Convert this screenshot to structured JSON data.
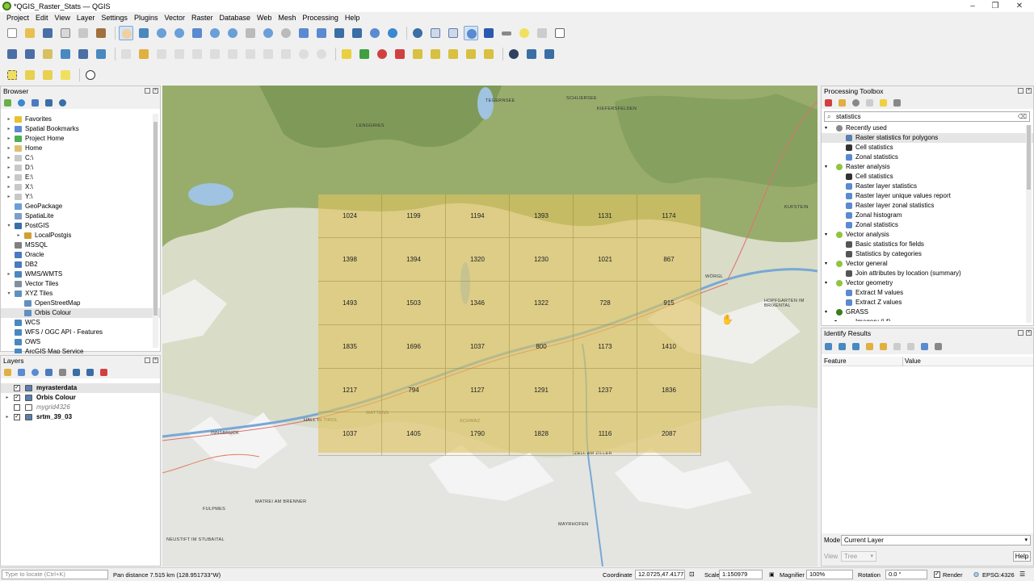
{
  "window": {
    "title": "*QGIS_Raster_Stats — QGIS",
    "minimize": "–",
    "restore": "❐",
    "close": "✕"
  },
  "menu": [
    "Project",
    "Edit",
    "View",
    "Layer",
    "Settings",
    "Plugins",
    "Vector",
    "Raster",
    "Database",
    "Web",
    "Mesh",
    "Processing",
    "Help"
  ],
  "browser": {
    "title": "Browser",
    "items": [
      {
        "label": "Favorites",
        "indent": 0,
        "icon": "star-icon",
        "color": "#e8c030",
        "arrow": "▸"
      },
      {
        "label": "Spatial Bookmarks",
        "indent": 0,
        "icon": "bookmark-icon",
        "color": "#5a8ad0",
        "arrow": "▸"
      },
      {
        "label": "Project Home",
        "indent": 0,
        "icon": "folder-icon",
        "color": "#4caf50",
        "arrow": "▸"
      },
      {
        "label": "Home",
        "indent": 0,
        "icon": "folder-icon",
        "color": "#e0c070",
        "arrow": "▸"
      },
      {
        "label": "C:\\",
        "indent": 0,
        "icon": "drive-icon",
        "color": "#c8c8c8",
        "arrow": "▸"
      },
      {
        "label": "D:\\",
        "indent": 0,
        "icon": "drive-icon",
        "color": "#c8c8c8",
        "arrow": "▸"
      },
      {
        "label": "E:\\",
        "indent": 0,
        "icon": "drive-icon",
        "color": "#c8c8c8",
        "arrow": "▸"
      },
      {
        "label": "X:\\",
        "indent": 0,
        "icon": "drive-icon",
        "color": "#c8c8c8",
        "arrow": "▸"
      },
      {
        "label": "Y:\\",
        "indent": 0,
        "icon": "drive-icon",
        "color": "#c8c8c8",
        "arrow": "▸"
      },
      {
        "label": "GeoPackage",
        "indent": 0,
        "icon": "geopackage-icon",
        "color": "#6a9fd8",
        "arrow": ""
      },
      {
        "label": "SpatiaLite",
        "indent": 0,
        "icon": "spatialite-icon",
        "color": "#7aa0c8",
        "arrow": ""
      },
      {
        "label": "PostGIS",
        "indent": 0,
        "icon": "postgis-icon",
        "color": "#3a6ea5",
        "arrow": "▾"
      },
      {
        "label": "LocalPostgis",
        "indent": 1,
        "icon": "connection-icon",
        "color": "#d0a030",
        "arrow": "▸"
      },
      {
        "label": "MSSQL",
        "indent": 0,
        "icon": "mssql-icon",
        "color": "#808080",
        "arrow": ""
      },
      {
        "label": "Oracle",
        "indent": 0,
        "icon": "oracle-icon",
        "color": "#4a7ac0",
        "arrow": ""
      },
      {
        "label": "DB2",
        "indent": 0,
        "icon": "db2-icon",
        "color": "#4a7ac0",
        "arrow": ""
      },
      {
        "label": "WMS/WMTS",
        "indent": 0,
        "icon": "wms-icon",
        "color": "#4a88c0",
        "arrow": "▸"
      },
      {
        "label": "Vector Tiles",
        "indent": 0,
        "icon": "vector-tiles-icon",
        "color": "#8090a0",
        "arrow": ""
      },
      {
        "label": "XYZ Tiles",
        "indent": 0,
        "icon": "xyz-tiles-icon",
        "color": "#6090c0",
        "arrow": "▾"
      },
      {
        "label": "OpenStreetMap",
        "indent": 1,
        "icon": "xyz-tiles-icon",
        "color": "#6090c0",
        "arrow": ""
      },
      {
        "label": "Orbis Colour",
        "indent": 1,
        "icon": "xyz-tiles-icon",
        "color": "#6090c0",
        "arrow": "",
        "selected": true
      },
      {
        "label": "WCS",
        "indent": 0,
        "icon": "wcs-icon",
        "color": "#4a88c0",
        "arrow": ""
      },
      {
        "label": "WFS / OGC API - Features",
        "indent": 0,
        "icon": "wfs-icon",
        "color": "#4a88c0",
        "arrow": ""
      },
      {
        "label": "OWS",
        "indent": 0,
        "icon": "ows-icon",
        "color": "#4a88c0",
        "arrow": ""
      },
      {
        "label": "ArcGIS Map Service",
        "indent": 0,
        "icon": "arcgis-icon",
        "color": "#4a88c0",
        "arrow": ""
      }
    ]
  },
  "layers": {
    "title": "Layers",
    "items": [
      {
        "label": "myrasterdata",
        "checked": true,
        "bold": true,
        "italic": false,
        "selected": true,
        "arrow": ""
      },
      {
        "label": "Orbis Colour",
        "checked": true,
        "bold": true,
        "italic": false,
        "selected": false,
        "arrow": "▸"
      },
      {
        "label": "mygrid4326",
        "checked": false,
        "bold": false,
        "italic": true,
        "selected": false,
        "arrow": ""
      },
      {
        "label": "srtm_39_03",
        "checked": true,
        "bold": true,
        "italic": false,
        "selected": false,
        "arrow": "▸"
      }
    ]
  },
  "grid_values": [
    [
      "1024",
      "1199",
      "1194",
      "1393",
      "1131",
      "1174"
    ],
    [
      "1398",
      "1394",
      "1320",
      "1230",
      "1021",
      "867"
    ],
    [
      "1493",
      "1503",
      "1346",
      "1322",
      "728",
      "915"
    ],
    [
      "1835",
      "1696",
      "1037",
      "800",
      "1173",
      "1410"
    ],
    [
      "1217",
      "794",
      "1127",
      "1291",
      "1237",
      "1836"
    ],
    [
      "1037",
      "1405",
      "1790",
      "1828",
      "1116",
      "2087"
    ]
  ],
  "toolbox": {
    "title": "Processing Toolbox",
    "search_value": "statistics",
    "rows": [
      {
        "label": "Recently used",
        "level": 0,
        "arrow": "▾",
        "icon": "clock-icon",
        "color": "#888"
      },
      {
        "label": "Raster statistics for polygons",
        "level": 1,
        "icon": "gear-icon",
        "color": "#5a7fb0",
        "selected": true
      },
      {
        "label": "Cell statistics",
        "level": 1,
        "icon": "grid-icon",
        "color": "#333"
      },
      {
        "label": "Zonal statistics",
        "level": 1,
        "icon": "gear-icon",
        "color": "#5a8ad0"
      },
      {
        "label": "Raster analysis",
        "level": 0,
        "arrow": "▾",
        "icon": "qgis-icon",
        "color": "#8dc63f"
      },
      {
        "label": "Cell statistics",
        "level": 1,
        "icon": "grid-icon",
        "color": "#333"
      },
      {
        "label": "Raster layer statistics",
        "level": 1,
        "icon": "gear-icon",
        "color": "#5a8ad0"
      },
      {
        "label": "Raster layer unique values report",
        "level": 1,
        "icon": "gear-icon",
        "color": "#5a8ad0"
      },
      {
        "label": "Raster layer zonal statistics",
        "level": 1,
        "icon": "gear-icon",
        "color": "#5a8ad0"
      },
      {
        "label": "Zonal histogram",
        "level": 1,
        "icon": "gear-icon",
        "color": "#5a8ad0"
      },
      {
        "label": "Zonal statistics",
        "level": 1,
        "icon": "gear-icon",
        "color": "#5a8ad0"
      },
      {
        "label": "Vector analysis",
        "level": 0,
        "arrow": "▾",
        "icon": "qgis-icon",
        "color": "#8dc63f"
      },
      {
        "label": "Basic statistics for fields",
        "level": 1,
        "icon": "sigma-icon",
        "color": "#555"
      },
      {
        "label": "Statistics by categories",
        "level": 1,
        "icon": "sigma-icon",
        "color": "#555"
      },
      {
        "label": "Vector general",
        "level": 0,
        "arrow": "▾",
        "icon": "qgis-icon",
        "color": "#8dc63f"
      },
      {
        "label": "Join attributes by location (summary)",
        "level": 1,
        "icon": "sigma-icon",
        "color": "#555"
      },
      {
        "label": "Vector geometry",
        "level": 0,
        "arrow": "▾",
        "icon": "qgis-icon",
        "color": "#8dc63f"
      },
      {
        "label": "Extract M values",
        "level": 1,
        "icon": "gear-icon",
        "color": "#5a8ad0"
      },
      {
        "label": "Extract Z values",
        "level": 1,
        "icon": "gear-icon",
        "color": "#5a8ad0"
      },
      {
        "label": "GRASS",
        "level": 0,
        "arrow": "▾",
        "icon": "grass-icon",
        "color": "#3a7d1a"
      },
      {
        "label": "Imagery (i.*)",
        "level": 1,
        "arrow": "▾",
        "icon": "",
        "color": ""
      }
    ]
  },
  "identify": {
    "title": "Identify Results",
    "col_feature": "Feature",
    "col_value": "Value",
    "mode_label": "Mode",
    "mode_value": "Current Layer",
    "view_label": "View",
    "view_value": "Tree",
    "help_label": "Help"
  },
  "status": {
    "locator_placeholder": "Type to locate (Ctrl+K)",
    "message": "Pan distance 7.515 km (128.951733°W)",
    "coordinate_label": "Coordinate",
    "coordinate_value": "12.0725,47.4177",
    "scale_label": "Scale",
    "scale_value": "1:150979",
    "magnifier_label": "Magnifier",
    "magnifier_value": "100%",
    "rotation_label": "Rotation",
    "rotation_value": "0.0 °",
    "render_label": "Render",
    "crs_label": "EPSG:4326"
  },
  "map_labels": [
    "INNSBRUCK",
    "WATTENS",
    "SCHWAZ",
    "HALL IN TIROL",
    "MAYRHOFEN",
    "FULPMES",
    "MATREI AM BRENNER",
    "LENGGRIES",
    "TEGERNSEE",
    "SCHLIERSEE",
    "KIEFERSFELDEN",
    "KUFSTEIN",
    "WÖRGL",
    "HOPFGARTEN IM BRIXENTAL",
    "ZELL AM ZILLER",
    "NEUSTIFT IM STUBAITAL"
  ]
}
